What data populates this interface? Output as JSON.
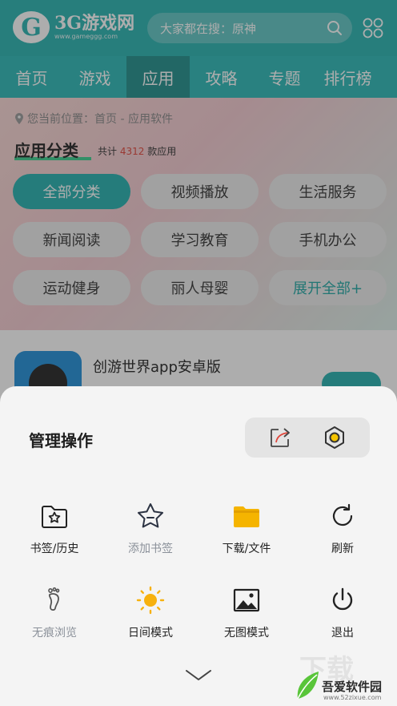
{
  "header": {
    "logo_name": "3G游戏网",
    "logo_url": "www.gameggg.com",
    "search_placeholder": "大家都在搜：原神"
  },
  "nav": {
    "items": [
      "首页",
      "游戏",
      "应用",
      "攻略",
      "专题",
      "排行榜"
    ],
    "active": "应用"
  },
  "breadcrumb": "您当前位置：首页 - 应用软件",
  "section": {
    "title": "应用分类",
    "count_prefix": "共计",
    "count": "4312",
    "count_suffix": "款应用"
  },
  "categories": [
    "全部分类",
    "视频播放",
    "生活服务",
    "新闻阅读",
    "学习教育",
    "手机办公",
    "运动健身",
    "丽人母婴",
    "展开全部+"
  ],
  "app_preview": {
    "name": "创游世界app安卓版"
  },
  "sheet": {
    "title": "管理操作",
    "quick_actions": [
      {
        "icon": "share-icon"
      },
      {
        "icon": "settings-icon"
      }
    ],
    "menu": [
      {
        "label": "书签/历史",
        "icon": "bookmark-folder-icon",
        "enabled": true
      },
      {
        "label": "添加书签",
        "icon": "star-icon",
        "enabled": false
      },
      {
        "label": "下载/文件",
        "icon": "folder-icon",
        "enabled": true
      },
      {
        "label": "刷新",
        "icon": "refresh-icon",
        "enabled": true
      },
      {
        "label": "无痕浏览",
        "icon": "footprint-icon",
        "enabled": false
      },
      {
        "label": "日间模式",
        "icon": "sun-icon",
        "enabled": true
      },
      {
        "label": "无图模式",
        "icon": "image-icon",
        "enabled": true
      },
      {
        "label": "退出",
        "icon": "power-icon",
        "enabled": true
      }
    ]
  },
  "watermark": {
    "bg_text": "下载",
    "name": "吾爱软件园",
    "url": "www.52zixue.com"
  },
  "colors": {
    "brand": "#28b3b1",
    "folder": "#f5b400",
    "sun": "#f7b10e"
  }
}
